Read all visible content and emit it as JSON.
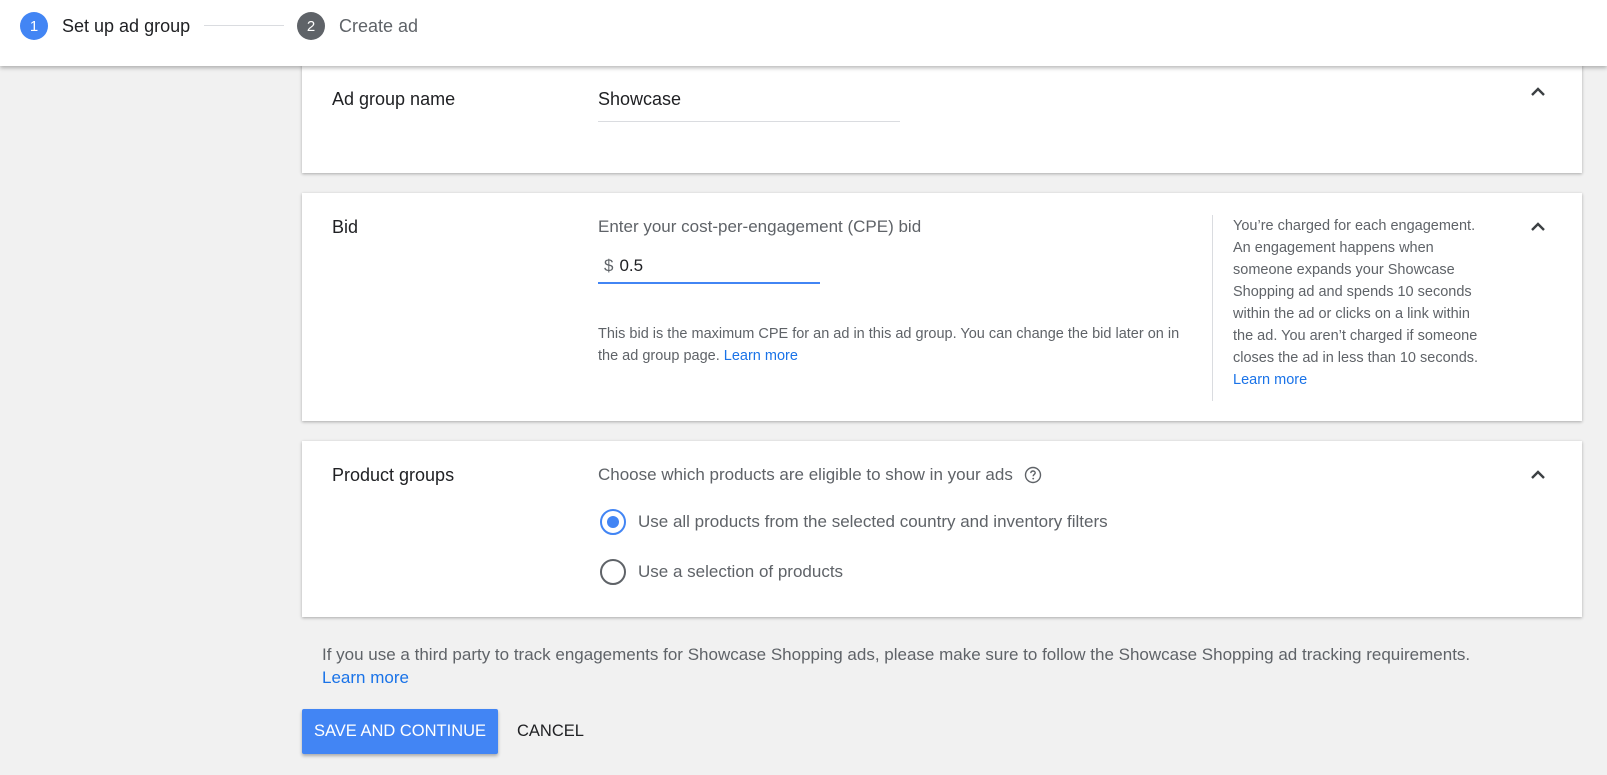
{
  "stepper": {
    "step1": {
      "number": "1",
      "label": "Set up ad group"
    },
    "step2": {
      "number": "2",
      "label": "Create ad"
    }
  },
  "ad_group_name": {
    "title": "Ad group name",
    "value": "Showcase"
  },
  "bid": {
    "title": "Bid",
    "prompt": "Enter your cost-per-engagement (CPE) bid",
    "currency": "$",
    "value": "0.5",
    "help_text": "This bid is the maximum CPE for an ad in this ad group. You can change the bid later on in the ad group page.",
    "help_link": "Learn more",
    "side_help_text": "You’re charged for each engagement. An engagement happens when someone expands your Showcase Shopping ad and spends 10 seconds within the ad or clicks on a link within the ad. You aren’t charged if someone closes the ad in less than 10 seconds.",
    "side_help_link": "Learn more"
  },
  "product_groups": {
    "title": "Product groups",
    "prompt": "Choose which products are eligible to show in your ads",
    "options": [
      {
        "label": "Use all products from the selected country and inventory filters",
        "selected": true
      },
      {
        "label": "Use a selection of products",
        "selected": false
      }
    ]
  },
  "footer": {
    "note": "If you use a third party to track engagements for Showcase Shopping ads, please make sure to follow the Showcase Shopping ad tracking requirements.",
    "note_link": "Learn more"
  },
  "actions": {
    "save_label": "SAVE AND CONTINUE",
    "cancel_label": "CANCEL"
  },
  "colors": {
    "accent": "#4285f4",
    "link": "#1a73e8",
    "background": "#f1f1f1"
  },
  "icons": [
    "chevron-up-icon",
    "help-circle-icon",
    "radio-checked-icon",
    "radio-unchecked-icon"
  ]
}
